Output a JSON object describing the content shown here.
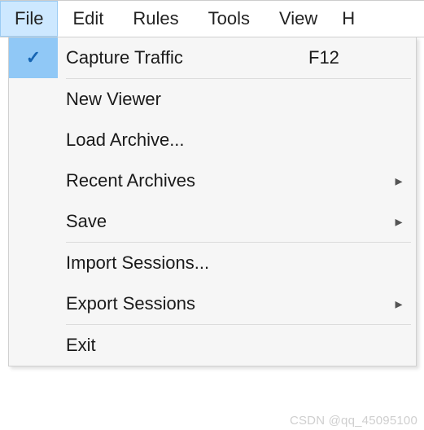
{
  "menubar": {
    "items": [
      {
        "label": "File",
        "selected": true
      },
      {
        "label": "Edit",
        "selected": false
      },
      {
        "label": "Rules",
        "selected": false
      },
      {
        "label": "Tools",
        "selected": false
      },
      {
        "label": "View",
        "selected": false
      },
      {
        "label": "H",
        "selected": false
      }
    ]
  },
  "file_menu": {
    "items": [
      {
        "label": "Capture Traffic",
        "checked": true,
        "accel": "F12",
        "submenu": false,
        "sep_after": true
      },
      {
        "label": "New Viewer",
        "checked": false,
        "accel": "",
        "submenu": false,
        "sep_after": false
      },
      {
        "label": "Load Archive...",
        "checked": false,
        "accel": "",
        "submenu": false,
        "sep_after": false
      },
      {
        "label": "Recent Archives",
        "checked": false,
        "accel": "",
        "submenu": true,
        "sep_after": false
      },
      {
        "label": "Save",
        "checked": false,
        "accel": "",
        "submenu": true,
        "sep_after": true
      },
      {
        "label": "Import Sessions...",
        "checked": false,
        "accel": "",
        "submenu": false,
        "sep_after": false
      },
      {
        "label": "Export Sessions",
        "checked": false,
        "accel": "",
        "submenu": true,
        "sep_after": true
      },
      {
        "label": "Exit",
        "checked": false,
        "accel": "",
        "submenu": false,
        "sep_after": false
      }
    ]
  },
  "watermark": "CSDN @qq_45095100"
}
